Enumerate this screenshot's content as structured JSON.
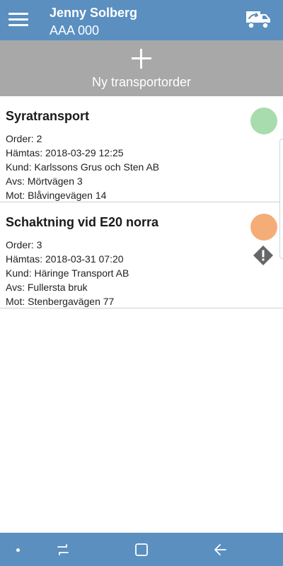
{
  "header": {
    "user_name": "Jenny Solberg",
    "vehicle_id": "AAA 000",
    "menu_icon": "hamburger-menu-icon",
    "truck_icon": "truck-transfer-icon",
    "background_color": "#5a8fc0"
  },
  "new_order": {
    "label": "Ny transportorder",
    "icon": "plus-icon",
    "background_color": "#a8a8a8"
  },
  "orders": [
    {
      "title": "Syratransport",
      "order": "Order: 2",
      "pickup": "Hämtas: 2018-03-29 12:25",
      "customer": "Kund: Karlssons Grus och Sten AB",
      "from": "Avs: Mörtvägen 3",
      "to": "Mot: Blåvingevägen 14",
      "status_color": "#a8dcae",
      "warning": false
    },
    {
      "title": "Schaktning vid E20 norra",
      "order": "Order: 3",
      "pickup": "Hämtas: 2018-03-31 07:20",
      "customer": "Kund: Häringe Transport AB",
      "from": "Avs: Fullersta bruk",
      "to": "Mot: Stenbergavägen 77",
      "status_color": "#f5ad77",
      "warning": true,
      "warning_icon": "warning-diamond-icon"
    }
  ],
  "nav_bar": {
    "icons": [
      "dot-icon",
      "recent-apps-icon",
      "home-icon",
      "back-icon"
    ],
    "background_color": "#5a8fc0"
  }
}
